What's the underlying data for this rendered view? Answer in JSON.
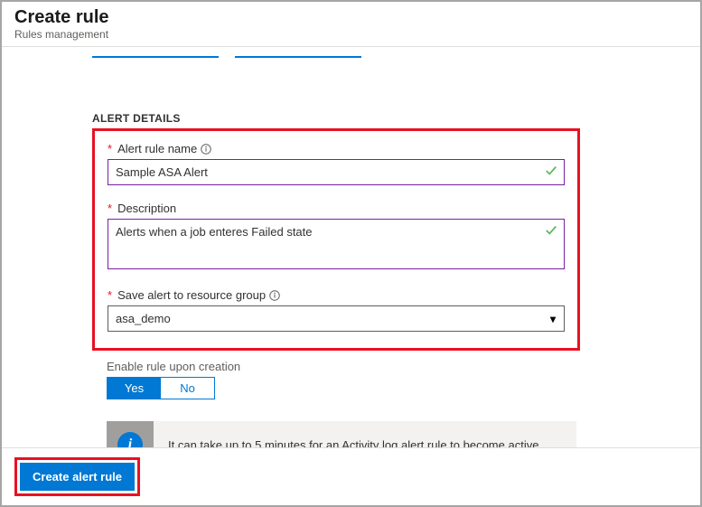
{
  "header": {
    "title": "Create rule",
    "subtitle": "Rules management"
  },
  "section": {
    "title": "ALERT DETAILS"
  },
  "fields": {
    "rule_name": {
      "label": "Alert rule name",
      "value": "Sample ASA Alert",
      "required": true,
      "info": true,
      "valid": true
    },
    "description": {
      "label": "Description",
      "value": "Alerts when a job enteres Failed state",
      "required": true,
      "valid": true
    },
    "resource_group": {
      "label": "Save alert to resource group",
      "required": true,
      "info": true,
      "value": "asa_demo"
    }
  },
  "enable": {
    "label": "Enable rule upon creation",
    "yes": "Yes",
    "no": "No",
    "selected": "yes"
  },
  "banner": {
    "message": "It can take up to 5 minutes for an Activity log alert rule to become active."
  },
  "footer": {
    "create_label": "Create alert rule"
  }
}
